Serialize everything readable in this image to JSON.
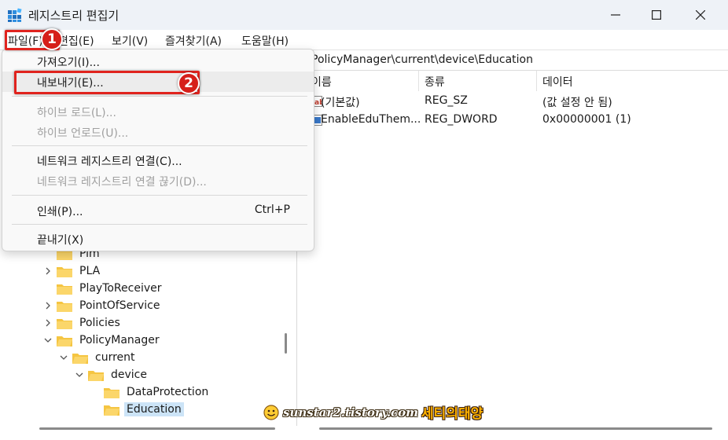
{
  "window": {
    "title": "레지스트리 편집기"
  },
  "menubar": {
    "items": [
      "파일(F)",
      "편집(E)",
      "보기(V)",
      "즐겨찾기(A)",
      "도움말(H)"
    ]
  },
  "address": {
    "path": "PolicyManager\\current\\device\\Education"
  },
  "file_menu": {
    "items": [
      {
        "label": "가져오기(I)...",
        "enabled": true
      },
      {
        "label": "내보내기(E)...",
        "enabled": true,
        "highlighted": true
      },
      {
        "label": "하이브 로드(L)...",
        "enabled": false
      },
      {
        "label": "하이브 언로드(U)...",
        "enabled": false
      },
      {
        "label": "네트워크 레지스트리 연결(C)...",
        "enabled": true
      },
      {
        "label": "네트워크 레지스트리 연결 끊기(D)...",
        "enabled": false
      },
      {
        "label": "인쇄(P)...",
        "enabled": true,
        "shortcut": "Ctrl+P"
      },
      {
        "label": "끝내기(X)",
        "enabled": true
      }
    ]
  },
  "tree": {
    "items": [
      {
        "label": "Pim",
        "expanded": false,
        "selected": false
      },
      {
        "label": "PLA",
        "expanded": false,
        "selected": false
      },
      {
        "label": "PlayToReceiver",
        "expanded": false,
        "selected": false
      },
      {
        "label": "PointOfService",
        "expanded": false,
        "selected": false
      },
      {
        "label": "Policies",
        "expanded": false,
        "selected": false
      },
      {
        "label": "PolicyManager",
        "expanded": true,
        "selected": false
      },
      {
        "label": "current",
        "expanded": true,
        "selected": false
      },
      {
        "label": "device",
        "expanded": true,
        "selected": false
      },
      {
        "label": "DataProtection",
        "expanded": false,
        "selected": false
      },
      {
        "label": "Education",
        "expanded": false,
        "selected": true
      }
    ]
  },
  "values_table": {
    "columns": [
      "이름",
      "종류",
      "데이터"
    ],
    "rows": [
      {
        "name": "(기본값)",
        "type": "REG_SZ",
        "data": "(값 설정 안 됨)",
        "icon": "string-value-icon"
      },
      {
        "name": "EnableEduThem...",
        "type": "REG_DWORD",
        "data": "0x00000001 (1)",
        "icon": "binary-value-icon"
      }
    ]
  },
  "annotations": {
    "step1": "1",
    "step2": "2"
  },
  "watermark": {
    "url": "sunstar2.tistory.com",
    "name": "세티의태양"
  },
  "colors": {
    "highlight": "#e0231e",
    "badge": "#d61f1a",
    "folder": "#f5c542",
    "selection": "#cce4f7"
  }
}
